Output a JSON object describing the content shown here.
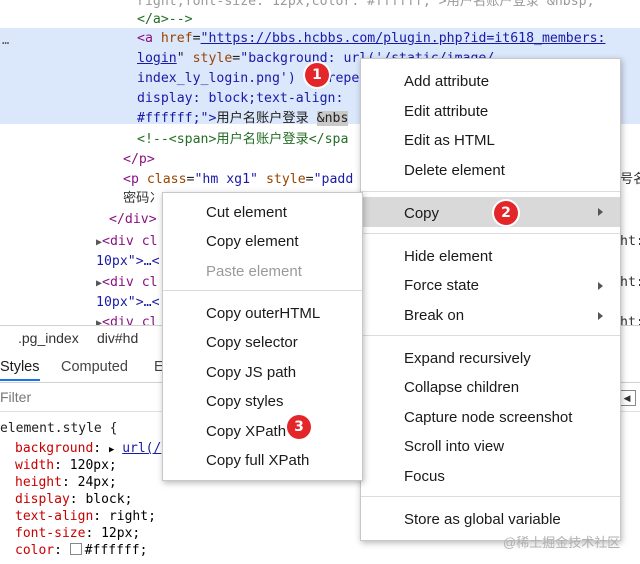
{
  "code": {
    "line0": "right;font-size: 12px;color: #ffffff;\">用户名账户登录 &nbsp;",
    "line1_close": "</a>-->",
    "a_open": "<a ",
    "href_attr": "href",
    "href_val": "https://bbs.hcbbs.com/plugin.php?id=it618_members:",
    "href_val2": "login",
    "style_attr": " style",
    "style_val": "\"background: url('/static/image/",
    "line4": "index_ly_login.png') no-repe",
    "line5": "display: block;text-align:",
    "line6a": "#ffffff;\">",
    "line6b": "用户名账户登录 ",
    "line6c": "&nbs",
    "line7": "<!--<span>用户名账户登录</spa",
    "line8": "</p>",
    "line9a": "<p ",
    "line9b": "class",
    "line9c": "\"hm xg1\"",
    "line9d": " style",
    "line9e": "\"padd",
    "line10": "密码冫",
    "line11": "</div>",
    "line12": "<div cl",
    "line13": "10px\">…<",
    "line14": "<div cl",
    "line15": "10px\">…<",
    "line16": "<div cl",
    "right_frag1": "号名",
    "right_frag2": "ht:",
    "right_frag3": "ht:",
    "right_frag4": "ht:",
    "dots": "…"
  },
  "breadcrumb": [
    ".pg_index",
    "div#hd"
  ],
  "tabs": [
    "Styles",
    "Computed",
    "E"
  ],
  "filter": {
    "placeholder": "Filter",
    "toggle": "◀"
  },
  "styles_pane": {
    "selector": "element.style {",
    "props": [
      {
        "name": "background",
        "value": "url(/"
      },
      {
        "name": "width",
        "value": "120px;"
      },
      {
        "name": "height",
        "value": "24px;"
      },
      {
        "name": "display",
        "value": "block;"
      },
      {
        "name": "text-align",
        "value": "right;"
      },
      {
        "name": "font-size",
        "value": "12px;"
      },
      {
        "name": "color",
        "value": "#ffffff;"
      }
    ]
  },
  "main_menu": {
    "items": [
      "Add attribute",
      "Edit attribute",
      "Edit as HTML",
      "Delete element",
      "Copy",
      "Hide element",
      "Force state",
      "Break on",
      "Expand recursively",
      "Collapse children",
      "Capture node screenshot",
      "Scroll into view",
      "Focus",
      "Store as global variable"
    ]
  },
  "copy_menu": {
    "items": [
      "Cut element",
      "Copy element",
      "Paste element",
      "Copy outerHTML",
      "Copy selector",
      "Copy JS path",
      "Copy styles",
      "Copy XPath",
      "Copy full XPath"
    ]
  },
  "badges": [
    "1",
    "2",
    "3"
  ],
  "watermark": "@稀土掘金技术社区",
  "colors": {
    "badge": "#e3262a",
    "selection": "#dbe7fb",
    "hover": "#d9d9d9"
  }
}
